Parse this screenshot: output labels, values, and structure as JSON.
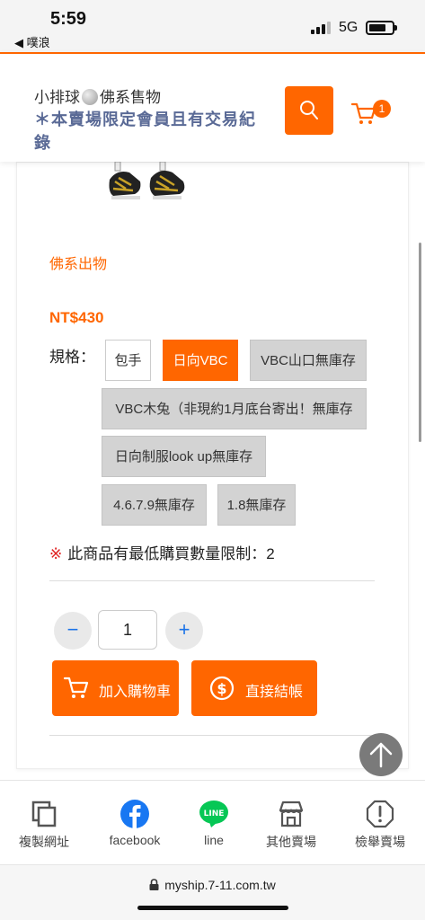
{
  "status_bar": {
    "time": "5:59",
    "back_app": "◀ 噗浪",
    "network": "5G"
  },
  "header": {
    "store_name_prefix": "小排球",
    "store_name_suffix": "佛系售物",
    "store_note": "＊本賣場限定會員且有交易紀錄",
    "cart_count": "1"
  },
  "product": {
    "category": "佛系出物",
    "price": "NT$430",
    "spec_label": "規格：",
    "options": [
      {
        "label": "包手",
        "state": "available"
      },
      {
        "label": "日向VBC",
        "state": "selected"
      },
      {
        "label": "VBC山口無庫存",
        "state": "out_of_stock"
      },
      {
        "label": "VBC木兔（非現約1月底台寄出！無庫存",
        "state": "out_of_stock"
      },
      {
        "label": "日向制服look up無庫存",
        "state": "out_of_stock"
      },
      {
        "label": "4.6.7.9無庫存",
        "state": "out_of_stock"
      },
      {
        "label": "1.8無庫存",
        "state": "out_of_stock"
      }
    ],
    "limit_mark": "※",
    "limit_text": "此商品有最低購買數量限制：2",
    "quantity": "1",
    "minus_label": "−",
    "plus_label": "+",
    "add_to_cart_label": "加入購物車",
    "checkout_label": "直接結帳"
  },
  "bottom_nav": {
    "items": [
      {
        "label": "複製網址",
        "icon": "copy-icon"
      },
      {
        "label": "facebook",
        "icon": "facebook-icon"
      },
      {
        "label": "line",
        "icon": "line-icon"
      },
      {
        "label": "其他賣場",
        "icon": "store-icon"
      },
      {
        "label": "檢舉賣場",
        "icon": "report-icon"
      }
    ]
  },
  "browser": {
    "url": "myship.7-11.com.tw"
  },
  "colors": {
    "accent": "#ff6600",
    "note_text": "#5a6a96",
    "out_of_stock_bg": "#d3d3d3",
    "facebook": "#1877f2",
    "line": "#06c755"
  }
}
